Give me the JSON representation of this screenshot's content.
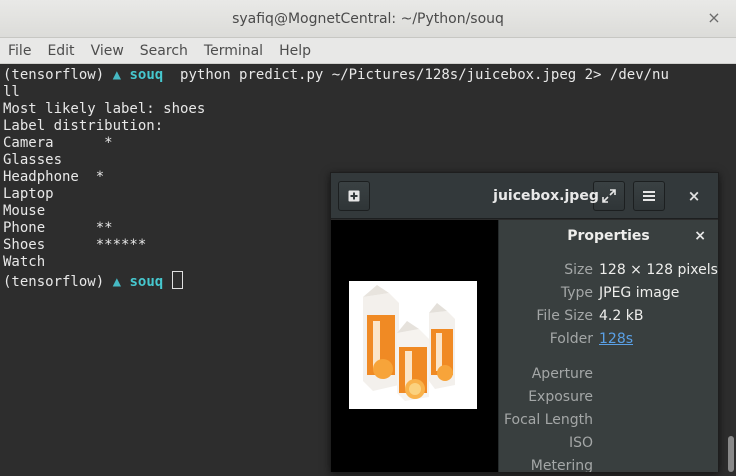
{
  "window": {
    "title": "syafiq@MognetCentral: ~/Python/souq",
    "close_glyph": "×"
  },
  "menu": [
    "File",
    "Edit",
    "View",
    "Search",
    "Terminal",
    "Help"
  ],
  "terminal": {
    "prompt_env": "(tensorflow)",
    "prompt_dir": "souq",
    "prompt_symbol": "⏶",
    "command": "python predict.py ~/Pictures/128s/juicebox.jpeg 2> /dev/nu",
    "command_wrap": "ll",
    "output": [
      "Most likely label: shoes",
      "Label distribution:",
      "Camera      *",
      "Glasses",
      "Headphone  *",
      "Laptop",
      "Mouse",
      "Phone      **",
      "Shoes      ******",
      "Watch"
    ],
    "colors": {
      "background": "#2d2d2d",
      "text": "#e8e8e8",
      "accent": "#46c8cf"
    }
  },
  "viewer": {
    "title": "juicebox.jpeg",
    "buttons": {
      "add_icon": "add-icon",
      "fullscreen_icon": "fullscreen-icon",
      "menu_icon": "menu-icon",
      "close": "×"
    },
    "properties": {
      "heading": "Properties",
      "close": "×",
      "rows": [
        {
          "label": "Size",
          "value": "128 × 128 pixels"
        },
        {
          "label": "Type",
          "value": "JPEG image"
        },
        {
          "label": "File Size",
          "value": "4.2 kB"
        },
        {
          "label": "Folder",
          "value": "128s"
        }
      ],
      "exif_labels": [
        "Aperture",
        "Exposure",
        "Focal Length",
        "ISO",
        "Metering"
      ]
    }
  }
}
